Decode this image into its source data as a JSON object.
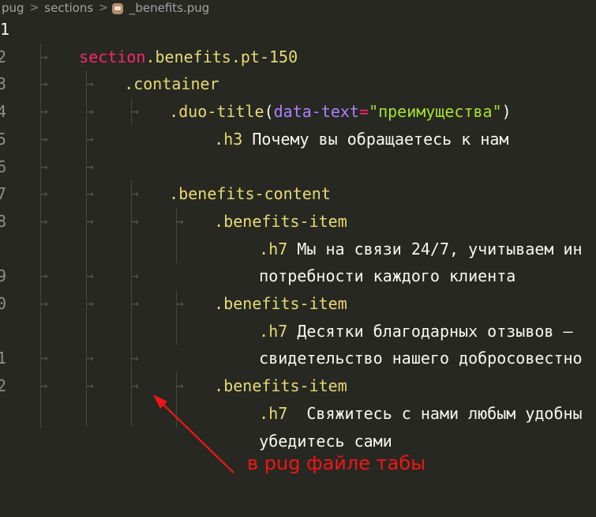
{
  "breadcrumb": {
    "items": [
      "pug",
      "sections",
      "_benefits.pug"
    ],
    "separator": ">",
    "file_icon": "pug-icon"
  },
  "editor": {
    "line_numbers": [
      "1",
      "2",
      "3",
      "4",
      "5",
      "6",
      "7",
      "8",
      "",
      "9",
      "0",
      "",
      "1",
      "2",
      ""
    ],
    "tab_glyph": "→",
    "code": {
      "l1": {
        "selector": "section",
        "class": ".benefits.pt-150"
      },
      "l2": {
        "class": ".container"
      },
      "l3": {
        "class": ".duo-title",
        "paren_open": "(",
        "attr": "data-text",
        "eq": "=",
        "value": "\"преимущества\"",
        "paren_close": ")"
      },
      "l4": {
        "class": ".h3",
        "text": "Почему вы обращаетесь к нам"
      },
      "l6": {
        "class": ".benefits-content"
      },
      "l7": {
        "class": ".benefits-item"
      },
      "l8a": {
        "class": ".h7",
        "text": "Мы на связи 24/7, учитываем ин"
      },
      "l8b": {
        "text": "потребности каждого клиента"
      },
      "l9": {
        "class": ".benefits-item"
      },
      "l10a": {
        "class": ".h7",
        "text": "Десятки благодарных отзывов –"
      },
      "l10b": {
        "text": "свидетельство нашего добросовестно"
      },
      "l11": {
        "class": ".benefits-item"
      },
      "l12a": {
        "class": ".h7",
        "text": " Свяжитесь с нами любым удобны"
      },
      "l12b": {
        "text": "убедитесь сами"
      }
    }
  },
  "annotation": {
    "text": "в pug файле табы",
    "color": "#f21515"
  },
  "colors": {
    "background": "#272822",
    "selector": "#f92672",
    "class": "#e6db74",
    "attribute": "#ae81ff",
    "string": "#a6e22e",
    "text": "#f8f8f2"
  }
}
